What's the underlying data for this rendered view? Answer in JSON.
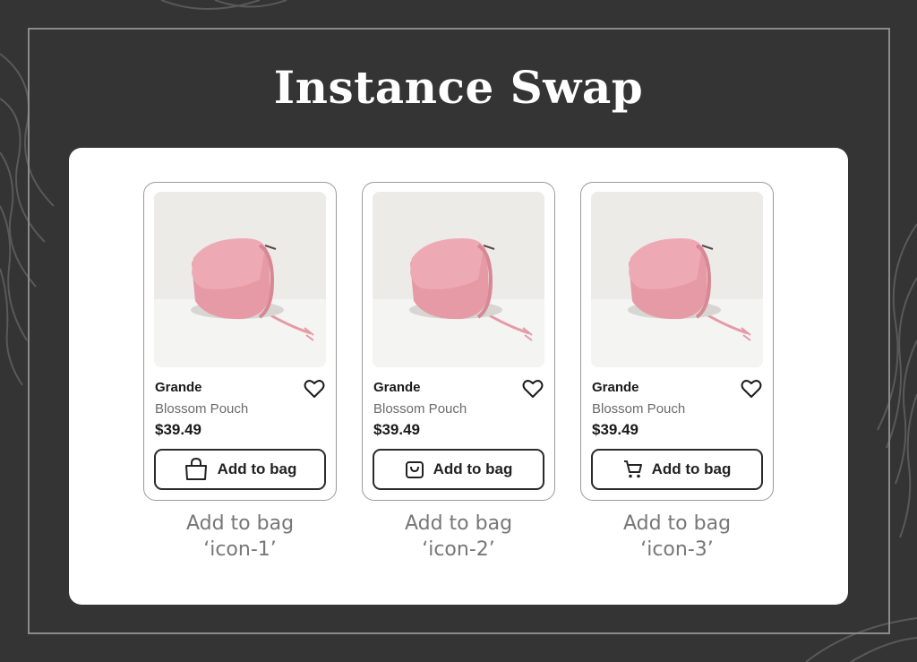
{
  "title": "Instance Swap",
  "cards": [
    {
      "brand": "Grande",
      "product": "Blossom Pouch",
      "price": "$39.49",
      "button_label": "Add to bag",
      "button_icon": "shopping-bag-icon",
      "caption_line1": "Add to bag",
      "caption_line2": "‘icon-1’"
    },
    {
      "brand": "Grande",
      "product": "Blossom Pouch",
      "price": "$39.49",
      "button_label": "Add to bag",
      "button_icon": "shopping-bag-small-icon",
      "caption_line1": "Add to bag",
      "caption_line2": "‘icon-2’"
    },
    {
      "brand": "Grande",
      "product": "Blossom Pouch",
      "price": "$39.49",
      "button_label": "Add to bag",
      "button_icon": "shopping-cart-icon",
      "caption_line1": "Add to bag",
      "caption_line2": "‘icon-3’"
    }
  ],
  "colors": {
    "background": "#343434",
    "panel": "#ffffff",
    "bag": "#eaa3ac",
    "text": "#1a1a1a",
    "muted": "#6b6b6b"
  }
}
